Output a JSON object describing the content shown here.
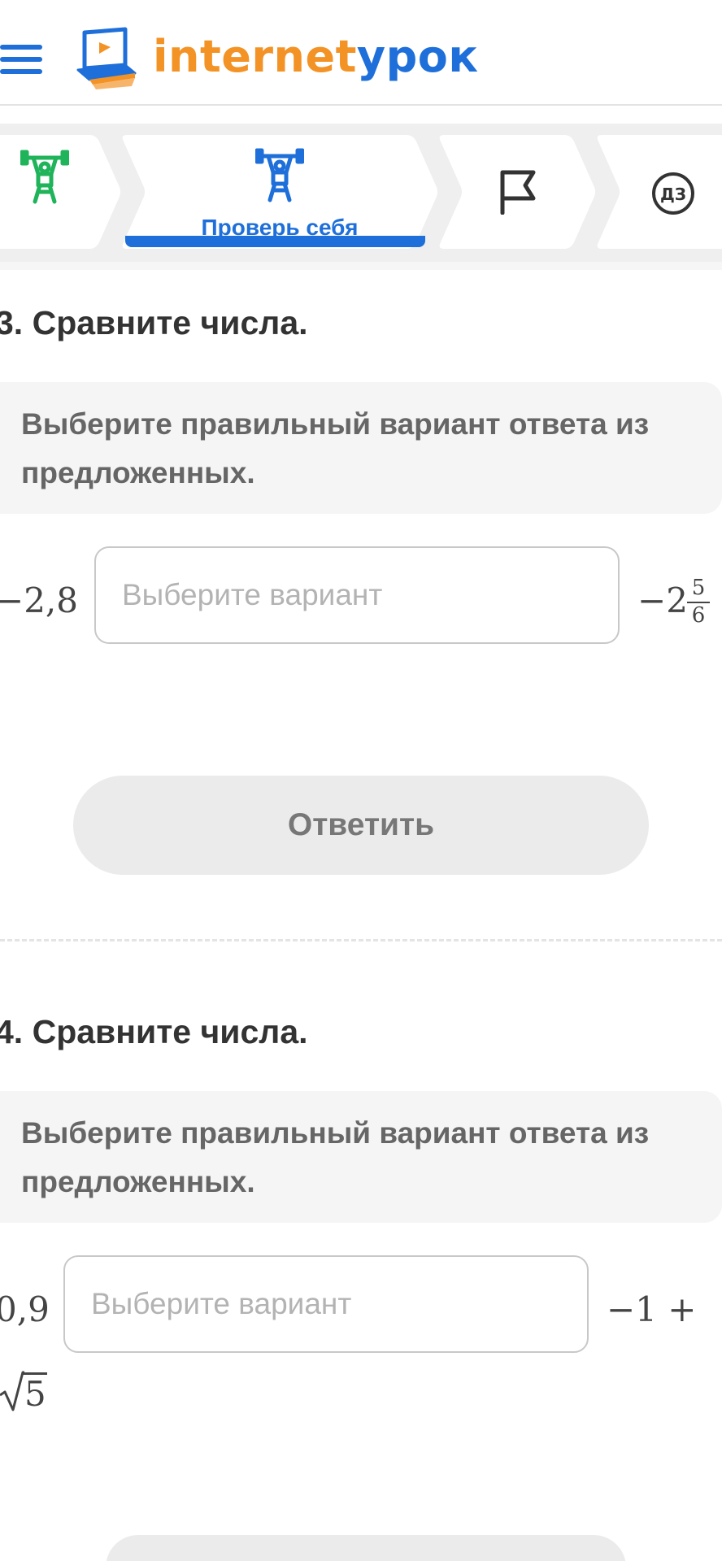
{
  "header": {
    "logo_part1": "internet",
    "logo_part2": "урок",
    "logo_icon": "book-laptop-icon",
    "menu_icon": "hamburger-menu-icon"
  },
  "steps": [
    {
      "icon": "weightlifter-icon",
      "label": "",
      "state": "done",
      "color": "#1fb35a"
    },
    {
      "icon": "weightlifter-icon",
      "label": "Проверь себя",
      "state": "active",
      "color": "#1e6fd9"
    },
    {
      "icon": "flag-icon",
      "label": "",
      "state": "normal",
      "color": "#333333"
    },
    {
      "icon": "homework-icon",
      "label": "",
      "icon_text": "ДЗ",
      "state": "normal",
      "color": "#333333"
    }
  ],
  "questions": [
    {
      "title": "3. Сравните числа.",
      "instruction_line1": "Выберите правильный вариант ответа из",
      "instruction_line2": "предложенных.",
      "left_value": "−2,8",
      "select_placeholder": "Выберите вариант",
      "right_whole": "−2",
      "right_numerator": "5",
      "right_denominator": "6",
      "button_label": "Ответить"
    },
    {
      "title": "4. Сравните числа.",
      "instruction_line1": "Выберите правильный вариант ответа из",
      "instruction_line2": "предложенных.",
      "left_value": "0,9",
      "select_placeholder": "Выберите вариант",
      "right_value_line1": "−1 +",
      "right_value_line2": "5"
    }
  ],
  "colors": {
    "brand_blue": "#1e6fd9",
    "brand_orange": "#f39325",
    "done_green": "#1fb35a"
  }
}
